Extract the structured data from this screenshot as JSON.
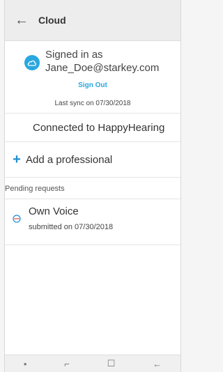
{
  "header": {
    "title": "Cloud",
    "back_icon": "arrow-left-icon"
  },
  "account": {
    "signed_in_label": "Signed in as",
    "email": "Jane_Doe@starkey.com",
    "sign_out_label": "Sign Out",
    "last_sync": "Last sync on 07/30/2018",
    "icon": "cloud-icon",
    "accent_color": "#29a7df"
  },
  "connection": {
    "label": "Connected to HappyHearing"
  },
  "add_professional": {
    "label": "Add a professional",
    "icon": "plus-icon"
  },
  "pending": {
    "section_label": "Pending requests",
    "items": [
      {
        "title": "Own Voice",
        "subtitle": "submitted on 07/30/2018",
        "icon": "pending-icon"
      }
    ]
  },
  "navbar": {
    "items": [
      "dot-icon",
      "recent-apps-icon",
      "home-icon",
      "back-icon"
    ]
  }
}
